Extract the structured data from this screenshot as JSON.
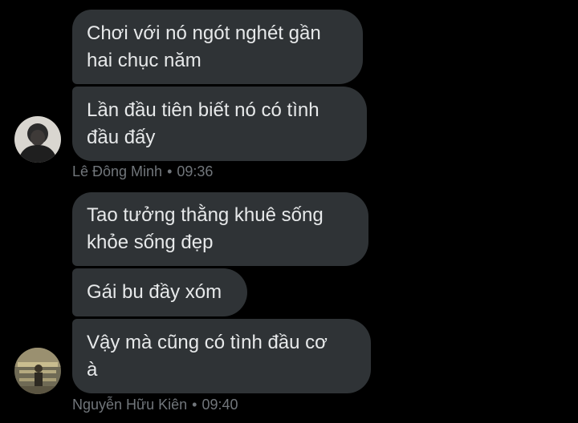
{
  "groups": [
    {
      "sender": "Lê Đông Minh",
      "time": "09:36",
      "messages": [
        "Chơi với nó ngót nghét gần\nhai chục năm",
        "Lần đầu tiên biết nó có tình\nđầu đấy"
      ]
    },
    {
      "sender": "Nguyễn Hữu Kiên",
      "time": "09:40",
      "messages": [
        "Tao tưởng thằng khuê sống\nkhỏe sống đẹp",
        "Gái bu đầy xóm",
        "Vậy mà cũng có tình đầu cơ\nà"
      ]
    }
  ],
  "separator": "•",
  "colors": {
    "background": "#000000",
    "bubble": "#2f3336",
    "text": "#e7e9ea",
    "meta": "#71767b"
  }
}
